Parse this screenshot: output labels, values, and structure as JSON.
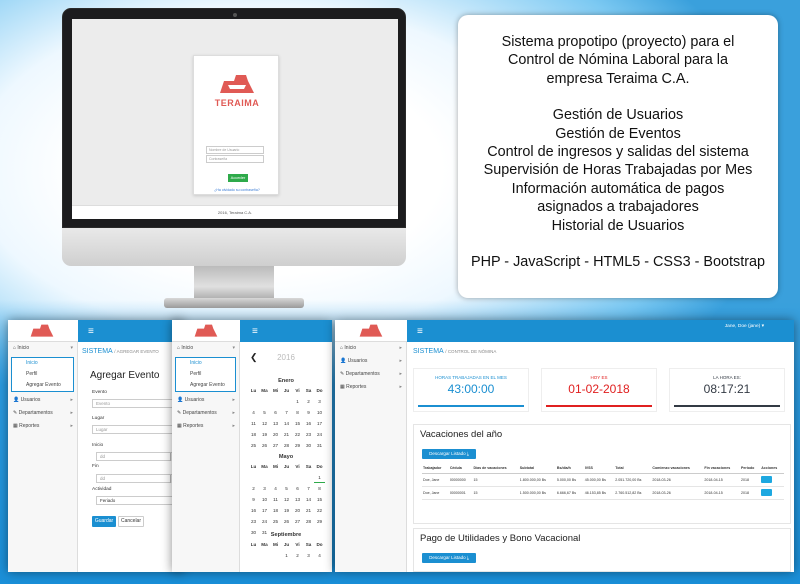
{
  "imac": {
    "login_logo": "TERAIMA",
    "username_placeholder": "Nombre de Usuario",
    "password_placeholder": "Contraseña",
    "login_button": "Acceder",
    "forgot_link": "¿Ha olvidado su contraseña?",
    "footer": "2016, Teraima C.A."
  },
  "description": {
    "intro": [
      "Sistema propotipo (proyecto) para el",
      "Control de Nómina Laboral para la",
      "empresa Teraima C.A."
    ],
    "features": [
      "Gestión de Usuarios",
      "Gestión de Eventos",
      "Control de ingresos y salidas del sistema",
      "Supervisión de Horas Trabajadas por Mes",
      "Información automática de pagos",
      "asignados a trabajadores",
      "Historial de Usuarios"
    ],
    "tech": "PHP - JavaScript - HTML5 - CSS3 - Bootstrap"
  },
  "sidebar": {
    "inicio": "Inicio",
    "sub_inicio": "Inicio",
    "sub_perfil": "Perfil",
    "sub_evento": "Agregar Evento",
    "usuarios": "Usuarios",
    "departamentos": "Departamentos",
    "reportes": "Reportes"
  },
  "panel1": {
    "crumb": "SISTEMA",
    "crumb_sub": "AGREGAR EVENTO",
    "form_title": "Agregar Evento",
    "evento_label": "Evento",
    "evento_placeholder": "Evento",
    "lugar_label": "Lugar",
    "lugar_placeholder": "Lugar",
    "inicio_label": "Inicio",
    "inicio_value": "dd",
    "fin_label": "Fin",
    "fin_value": "dd",
    "actividad_label": "Actividad",
    "actividad_value": "Feriado",
    "save_button": "Guardar",
    "cancel_button": "Cancelar"
  },
  "panel2": {
    "prev": "❮",
    "year": "2016",
    "months": [
      {
        "name": "Enero",
        "days": [
          "",
          "",
          "",
          "",
          "1",
          "2",
          "3",
          "4",
          "5",
          "6",
          "7",
          "8",
          "9",
          "10",
          "11",
          "12",
          "13",
          "14",
          "15",
          "16",
          "17",
          "18",
          "19",
          "20",
          "21",
          "22",
          "23",
          "24",
          "25",
          "26",
          "27",
          "28",
          "29",
          "30",
          "31"
        ]
      },
      {
        "name": "Mayo",
        "days": [
          "",
          "",
          "",
          "",
          "",
          "",
          "1",
          "2",
          "3",
          "4",
          "5",
          "6",
          "7",
          "8",
          "9",
          "10",
          "11",
          "12",
          "13",
          "14",
          "15",
          "16",
          "17",
          "18",
          "19",
          "20",
          "21",
          "22",
          "23",
          "24",
          "25",
          "26",
          "27",
          "28",
          "29",
          "30",
          "31"
        ]
      },
      {
        "name": "Septiembre",
        "days": [
          "",
          "",
          "",
          "1",
          "2",
          "3",
          "4"
        ]
      }
    ],
    "weekdays": [
      "Lu",
      "Ma",
      "Mi",
      "Ju",
      "Vi",
      "Sa",
      "Do"
    ]
  },
  "panel3": {
    "user_menu": "Jane, Doe (jane)",
    "crumb": "SISTEMA",
    "crumb_sub": "CONTROL DE NÓMINA",
    "stats": [
      {
        "label": "HORAS TRABAJADAS EN EL MES",
        "value": "43:00:00",
        "color": "#1b8fd1"
      },
      {
        "label": "HOY ES",
        "value": "01-02-2018",
        "color": "#e02020"
      },
      {
        "label": "LA HORA ES:",
        "value": "08:17:21",
        "color": "#333a44"
      }
    ],
    "vac_title": "Vacaciones del año",
    "vac_button": "Descargar Listado",
    "vac_headers": [
      "Trabajador",
      "Cédula",
      "Días de vacaciones",
      "Subtotal",
      "Bs/día/h",
      "IVSS",
      "Total",
      "Comienzo vacaciones",
      "Fin vacaciones",
      "Periodo",
      "Acciones"
    ],
    "vac_rows": [
      [
        "Doe, Jane",
        "00000000",
        "15",
        "1.800.000,00 Bs",
        "5.000,00 Bs",
        "45.000,00 Bs",
        "2.051.720,00 Bs",
        "2018-03-26",
        "2018-04-15",
        "2018"
      ],
      [
        "Doe, Jane",
        "00000001",
        "15",
        "1.500.000,00 Bs",
        "6.666,67 Bs",
        "46.153,85 Bs",
        "2.760.512,82 Bs",
        "2018-03-26",
        "2018-04-15",
        "2018"
      ]
    ],
    "util_title": "Pago de Utilidades y Bono Vacacional",
    "util_button": "Descargar Listado"
  }
}
